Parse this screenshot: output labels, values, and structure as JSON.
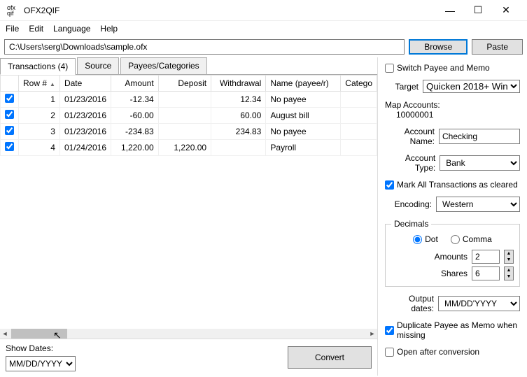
{
  "window": {
    "title": "OFX2QIF",
    "icon_text": "ofx\nqif"
  },
  "menu": [
    "File",
    "Edit",
    "Language",
    "Help"
  ],
  "path": "C:\\Users\\serg\\Downloads\\sample.ofx",
  "buttons": {
    "browse": "Browse",
    "paste": "Paste",
    "convert": "Convert"
  },
  "tabs": {
    "transactions": "Transactions (4)",
    "source": "Source",
    "payees": "Payees/Categories"
  },
  "grid": {
    "headers": {
      "check": "",
      "row": "Row #",
      "date": "Date",
      "amount": "Amount",
      "deposit": "Deposit",
      "withdrawal": "Withdrawal",
      "name": "Name (payee/r)",
      "category": "Catego"
    },
    "rows": [
      {
        "row": "1",
        "date": "01/23/2016",
        "amount": "-12.34",
        "deposit": "",
        "withdrawal": "12.34",
        "name": "No payee",
        "category": ""
      },
      {
        "row": "2",
        "date": "01/23/2016",
        "amount": "-60.00",
        "deposit": "",
        "withdrawal": "60.00",
        "name": "August bill",
        "category": ""
      },
      {
        "row": "3",
        "date": "01/23/2016",
        "amount": "-234.83",
        "deposit": "",
        "withdrawal": "234.83",
        "name": "No payee",
        "category": ""
      },
      {
        "row": "4",
        "date": "01/24/2016",
        "amount": "1,220.00",
        "deposit": "1,220.00",
        "withdrawal": "",
        "name": "Payroll",
        "category": ""
      }
    ]
  },
  "showDates": {
    "label": "Show Dates:",
    "value": "MM/DD/YYYY"
  },
  "right": {
    "switchPayee": "Switch Payee and Memo",
    "targetLabel": "Target",
    "targetValue": "Quicken 2018+ Win",
    "mapAccounts": "Map Accounts:",
    "accountId": "10000001",
    "accountNameLabel": "Account Name:",
    "accountNameValue": "Checking",
    "accountTypeLabel": "Account Type:",
    "accountTypeValue": "Bank",
    "markCleared": "Mark All Transactions as cleared",
    "encodingLabel": "Encoding:",
    "encodingValue": "Western",
    "decimalsLegend": "Decimals",
    "dot": "Dot",
    "comma": "Comma",
    "amountsLabel": "Amounts",
    "amountsValue": "2",
    "sharesLabel": "Shares",
    "sharesValue": "6",
    "outDatesLabel": "Output dates:",
    "outDatesValue": "MM/DD'YYYY",
    "duplicatePayee": "Duplicate Payee as Memo when missing",
    "openAfter": "Open after conversion"
  }
}
